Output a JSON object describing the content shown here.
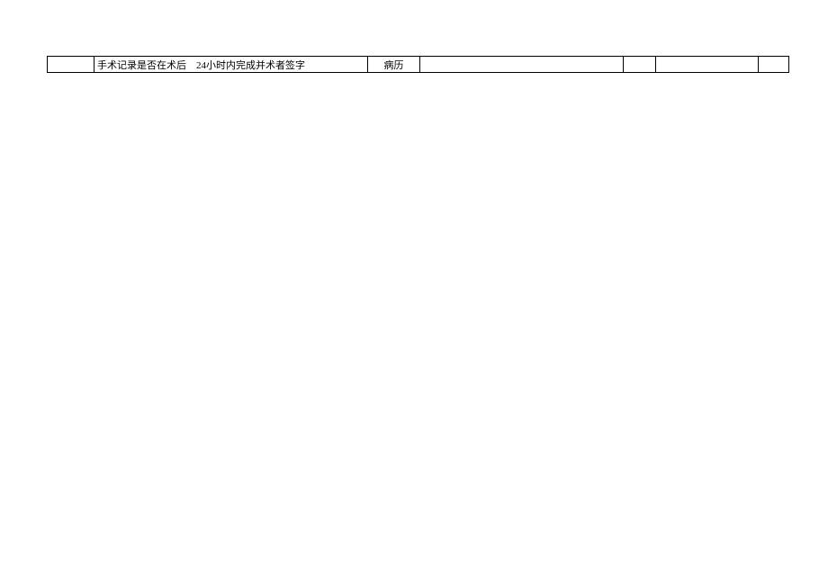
{
  "row": {
    "c2_part1": "手术记录是否在术后",
    "c2_part2": "24小时内完成并术者签字",
    "c3": "病历"
  }
}
